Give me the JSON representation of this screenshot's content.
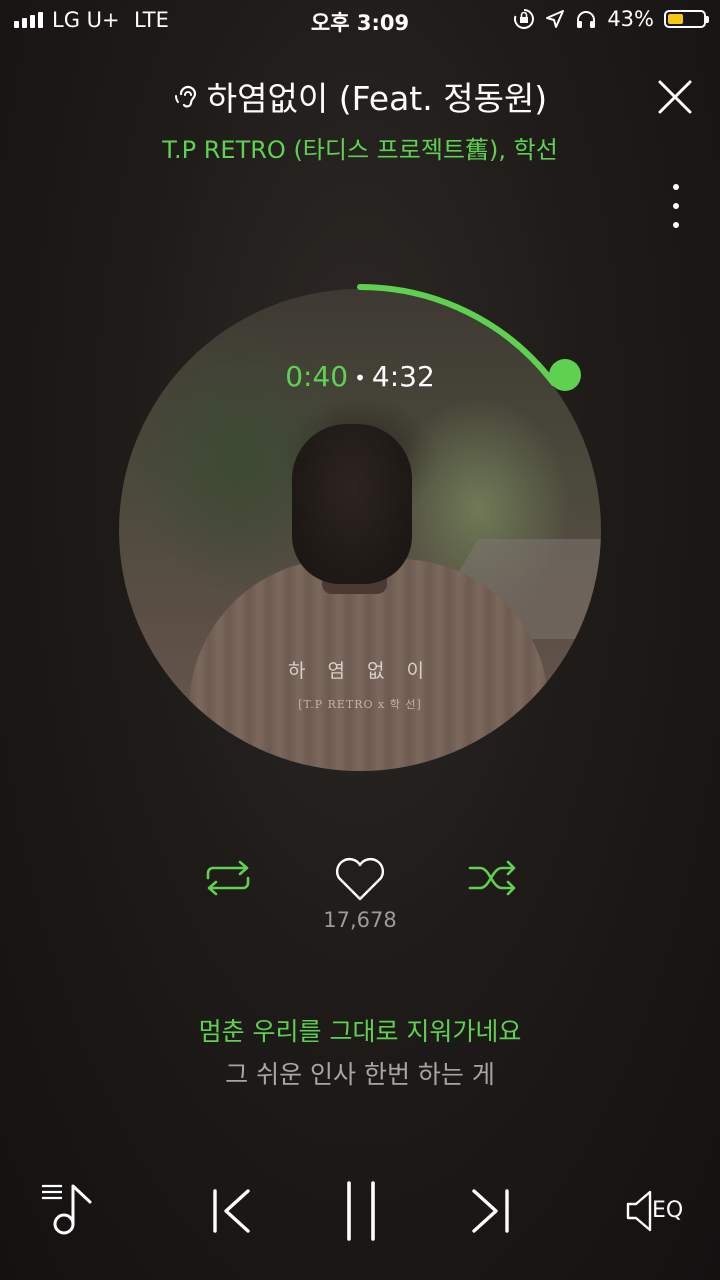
{
  "status_bar": {
    "carrier": "LG U+",
    "network": "LTE",
    "time": "오후 3:09",
    "battery_percent": "43%",
    "battery_level": 0.43,
    "icons": [
      "rotation-lock-icon",
      "location-icon",
      "headphones-icon",
      "battery-icon"
    ]
  },
  "header": {
    "title": "하염없이 (Feat. 정동원)",
    "artist": "T.P RETRO (타디스 프로젝트舊), 학선"
  },
  "album": {
    "art_title": "하 염 없 이",
    "art_subtitle": "[T.P RETRO x 학 선]"
  },
  "playback": {
    "elapsed": "0:40",
    "separator": "•",
    "total": "4:32",
    "progress": 0.147
  },
  "actions": {
    "like_count": "17,678"
  },
  "lyrics": {
    "current": "멈춘 우리를 그대로 지워가네요",
    "next": "그 쉬운 인사 한번 하는 게"
  },
  "bottom_bar": {
    "eq_label": "EQ"
  },
  "colors": {
    "accent": "#5fd151",
    "background": "#1e1b19",
    "text_secondary": "#a9a5a1"
  }
}
